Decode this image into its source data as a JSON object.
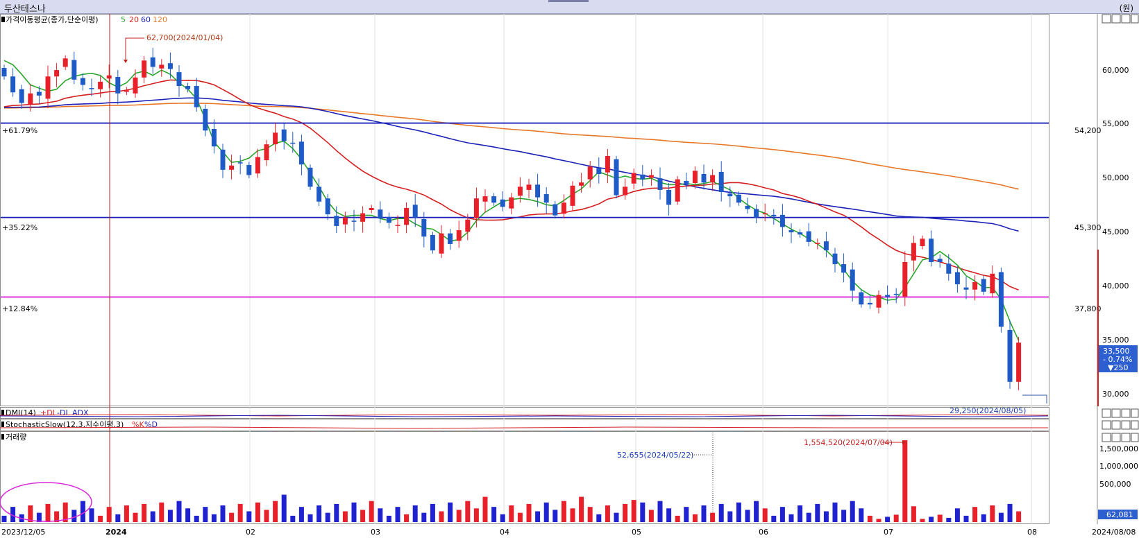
{
  "window": {
    "title": "두산테스나",
    "unit": "(원)"
  },
  "panels": {
    "price": {
      "legend_prefix": "가격이동평균(종가,단순이평)",
      "ma": [
        {
          "period": "5",
          "color": "#2aa52a"
        },
        {
          "period": "20",
          "color": "#d42020"
        },
        {
          "period": "60",
          "color": "#1c22b8"
        },
        {
          "period": "120",
          "color": "#e8782a"
        }
      ],
      "high_annotation": "62,700(2024/01/04)",
      "low_annotation": "29,250(2024/08/05)",
      "levels": [
        {
          "pct": "+61.79%",
          "price": "54,200",
          "value": 54200,
          "color": "#1c22b8"
        },
        {
          "pct": "+35.22%",
          "price": "45,300",
          "value": 45300,
          "color": "#1c22b8"
        },
        {
          "pct": "+12.84%",
          "price": "37,800",
          "value": 37800,
          "color": "#d82ad8"
        }
      ],
      "y_ticks": [
        "60,000",
        "55,000",
        "50,000",
        "45,000",
        "40,000",
        "35,000",
        "30,000"
      ],
      "current": {
        "price": "33,500",
        "change_pct": "- 0.74%",
        "change": "▼250"
      }
    },
    "dmi": {
      "name": "DMI(14)",
      "plus": "+DI",
      "minus": "-DI",
      "adx": "ADX"
    },
    "stochastic": {
      "name": "StochasticSlow(12,3,지수이평,3)",
      "k": "%K",
      "d": "%D"
    },
    "volume": {
      "name": "거래량",
      "y_ticks": [
        "1,500,000",
        "1,000,000",
        "500,000"
      ],
      "max_annotation": "1,554,520(2024/07/04)",
      "marker_annotation": "52,655(2024/05/22)",
      "current": "62,081"
    }
  },
  "x_axis": {
    "start": "2023/12/05",
    "end": "2024/08/08",
    "labels": [
      "2024",
      "02",
      "03",
      "04",
      "05",
      "06",
      "07",
      "08"
    ]
  },
  "chart_data": {
    "type": "candlestick",
    "y_range": [
      27500,
      64500
    ],
    "bars": 117,
    "close": [
      58600,
      57100,
      56100,
      57000,
      56800,
      58600,
      59200,
      60300,
      58300,
      57800,
      57400,
      58100,
      58700,
      57000,
      57300,
      58500,
      60100,
      59500,
      59700,
      59300,
      57700,
      57400,
      55700,
      53500,
      52000,
      49800,
      50200,
      50400,
      49300,
      51000,
      52200,
      53300,
      52500,
      52300,
      50300,
      48200,
      46800,
      45600,
      44500,
      45300,
      44900,
      45700,
      46200,
      45200,
      44800,
      44600,
      46200,
      45300,
      43500,
      42200,
      43800,
      42800,
      44100,
      45100,
      47100,
      47300,
      46700,
      46300,
      47200,
      48200,
      48400,
      47200,
      46700,
      45500,
      46700,
      48300,
      48600,
      50100,
      49400,
      51100,
      47400,
      48200,
      49500,
      48900,
      49300,
      47900,
      46500,
      48900,
      48400,
      49700,
      48600,
      49300,
      47700,
      47300,
      46700,
      46100,
      45300,
      45700,
      45400,
      44400,
      43900,
      43700,
      43000,
      42900,
      42200,
      40900,
      40100,
      38400,
      37100,
      37100,
      38000,
      37800,
      38000,
      41100,
      42900,
      43300,
      41100,
      41100,
      40000,
      39000,
      38500,
      39200,
      38300,
      40000,
      35000,
      29800,
      33500
    ],
    "ma5": [
      60100,
      59700,
      58800,
      57800,
      57500,
      57200,
      57400,
      58200,
      58600,
      58800,
      58900,
      58700,
      58000,
      57600,
      58000,
      58900,
      59100,
      58700,
      59200,
      58800,
      58000,
      57400,
      56500,
      54600,
      52400,
      51500,
      50500,
      50600,
      50900,
      51600,
      51800,
      52300,
      52500,
      51800,
      50800,
      49500,
      48200,
      46800,
      45800,
      45400,
      45500,
      45500,
      45500,
      45200,
      45000,
      45200,
      45200,
      44700,
      44300,
      44200,
      43700,
      43100,
      43200,
      43900,
      45000,
      45800,
      46300,
      46800,
      47000,
      47100,
      47000,
      46800,
      46500,
      46400,
      46900,
      47500,
      48000,
      48800,
      49600,
      49300,
      49000,
      49200,
      49000,
      48900,
      49000,
      48600,
      48400,
      48400,
      48500,
      48400,
      48500,
      48700,
      48300,
      47900,
      47100,
      46500,
      46000,
      45700,
      45200,
      44700,
      44200,
      43800,
      43300,
      42800,
      42200,
      41400,
      40400,
      39300,
      38500,
      38000,
      37800,
      37500,
      37600,
      38700,
      40000,
      41300,
      41500,
      42100,
      41500,
      40800,
      39800,
      39300,
      38700,
      38700,
      37600,
      35500,
      33700
    ]
  }
}
